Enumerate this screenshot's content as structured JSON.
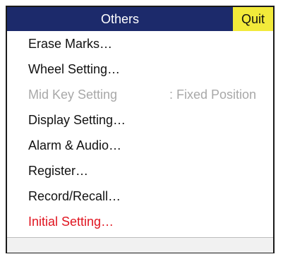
{
  "header": {
    "title": "Others",
    "quit_label": "Quit"
  },
  "menu": {
    "items": [
      {
        "label": "Erase Marks…"
      },
      {
        "label": "Wheel Setting…"
      },
      {
        "label": "Mid Key Setting",
        "value": ": Fixed Position",
        "state": "disabled"
      },
      {
        "label": "Display Setting…"
      },
      {
        "label": "Alarm & Audio…"
      },
      {
        "label": "Register…"
      },
      {
        "label": "Record/Recall…"
      },
      {
        "label": "Initial Setting…",
        "state": "highlighted"
      }
    ]
  },
  "colors": {
    "header_bg": "#1c2a6b",
    "quit_bg": "#f2ea3a",
    "disabled_text": "#a8a8a8",
    "highlight_text": "#e0141f"
  }
}
